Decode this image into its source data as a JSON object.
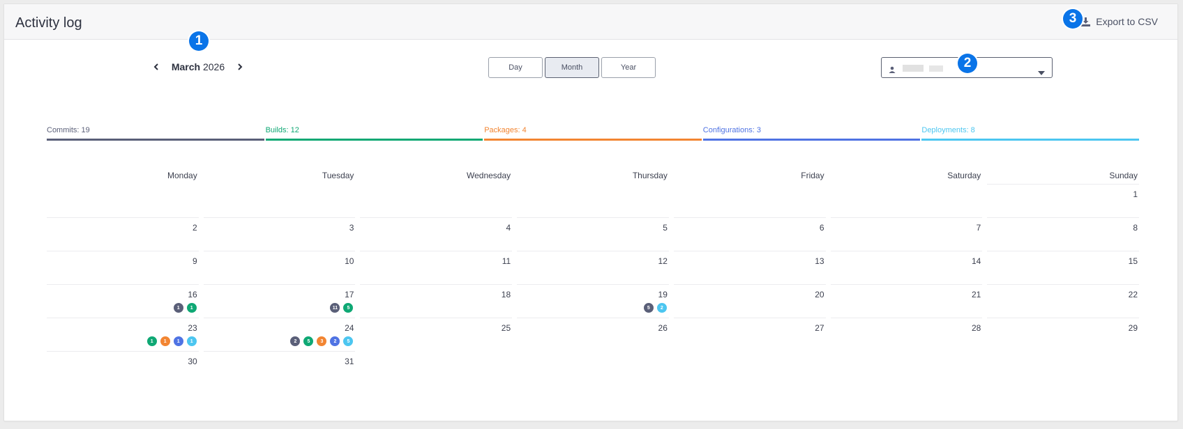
{
  "header": {
    "title": "Activity log",
    "export_label": "Export to CSV"
  },
  "badges": {
    "one": "1",
    "two": "2",
    "three": "3"
  },
  "nav": {
    "month": "March",
    "year": "2026"
  },
  "views": [
    "Day",
    "Month",
    "Year"
  ],
  "active_view": "Month",
  "colors": {
    "commits": "#5a5f78",
    "builds": "#0fa874",
    "packages": "#f28532",
    "configurations": "#4f73e3",
    "deployments": "#4cc6f0",
    "badge": "#0a74e8"
  },
  "stats": [
    {
      "key": "commits",
      "label": "Commits: 19"
    },
    {
      "key": "builds",
      "label": "Builds: 12"
    },
    {
      "key": "packages",
      "label": "Packages: 4"
    },
    {
      "key": "configurations",
      "label": "Configurations: 3"
    },
    {
      "key": "deployments",
      "label": "Deployments: 8"
    }
  ],
  "weekdays": [
    "Monday",
    "Tuesday",
    "Wednesday",
    "Thursday",
    "Friday",
    "Saturday",
    "Sunday"
  ],
  "weeks": [
    [
      null,
      null,
      null,
      null,
      null,
      null,
      {
        "d": "1"
      }
    ],
    [
      {
        "d": "2"
      },
      {
        "d": "3"
      },
      {
        "d": "4"
      },
      {
        "d": "5"
      },
      {
        "d": "6"
      },
      {
        "d": "7"
      },
      {
        "d": "8"
      }
    ],
    [
      {
        "d": "9"
      },
      {
        "d": "10"
      },
      {
        "d": "11"
      },
      {
        "d": "12"
      },
      {
        "d": "13"
      },
      {
        "d": "14"
      },
      {
        "d": "15"
      }
    ],
    [
      {
        "d": "16",
        "dots": [
          {
            "t": "commits",
            "n": "1"
          },
          {
            "t": "builds",
            "n": "1"
          }
        ]
      },
      {
        "d": "17",
        "dots": [
          {
            "t": "commits",
            "n": "11"
          },
          {
            "t": "builds",
            "n": "5"
          }
        ]
      },
      {
        "d": "18"
      },
      {
        "d": "19",
        "dots": [
          {
            "t": "commits",
            "n": "5"
          },
          {
            "t": "deployments",
            "n": "2"
          }
        ]
      },
      {
        "d": "20"
      },
      {
        "d": "21"
      },
      {
        "d": "22"
      }
    ],
    [
      {
        "d": "23",
        "dots": [
          {
            "t": "builds",
            "n": "1"
          },
          {
            "t": "packages",
            "n": "1"
          },
          {
            "t": "configurations",
            "n": "1"
          },
          {
            "t": "deployments",
            "n": "1"
          }
        ]
      },
      {
        "d": "24",
        "dots": [
          {
            "t": "commits",
            "n": "2"
          },
          {
            "t": "builds",
            "n": "5"
          },
          {
            "t": "packages",
            "n": "3"
          },
          {
            "t": "configurations",
            "n": "2"
          },
          {
            "t": "deployments",
            "n": "5"
          }
        ]
      },
      {
        "d": "25"
      },
      {
        "d": "26"
      },
      {
        "d": "27"
      },
      {
        "d": "28"
      },
      {
        "d": "29"
      }
    ],
    [
      {
        "d": "30"
      },
      {
        "d": "31"
      },
      null,
      null,
      null,
      null,
      null
    ]
  ]
}
